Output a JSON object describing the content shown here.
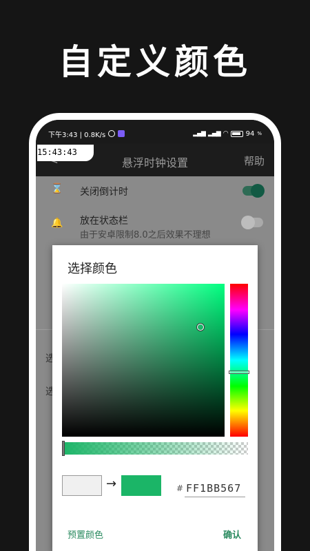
{
  "promo_title": "自定义颜色",
  "status_bar": {
    "left_text": "下午3:43 | 0.8K/s",
    "battery": "94"
  },
  "time_overlay": "15:43:43",
  "app_bar": {
    "back": "<",
    "title": "悬浮时钟设置",
    "help": "帮助"
  },
  "settings": {
    "countdown_label": "关闭倒计时",
    "statusbar_label": "放在状态栏",
    "statusbar_sub": "由于安卓限制8.0之后效果不理想",
    "side_char_1": "选",
    "side_char_2": "选"
  },
  "color_dialog": {
    "title": "选择颜色",
    "hex_prefix": "#",
    "hex_value": "FF1BB567",
    "preset_button": "预置颜色",
    "confirm_button": "确认",
    "arrow": "→",
    "colors": {
      "old": "#f0f0f0",
      "new": "#1bb567",
      "accent": "#2a8a5f"
    },
    "hue_level": 0.58,
    "alpha_level": 1.0
  }
}
